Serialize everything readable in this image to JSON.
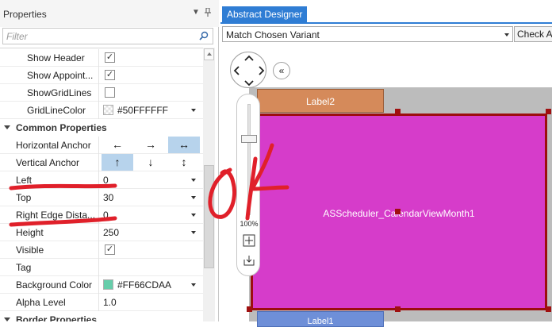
{
  "properties_panel": {
    "title": "Properties",
    "filter_placeholder": "Filter",
    "rows": [
      {
        "label": "Show Header",
        "checked": "✓"
      },
      {
        "label": "Show Appoint...",
        "checked": "✓"
      },
      {
        "label": "ShowGridLines",
        "checked": ""
      },
      {
        "label": "GridLineColor",
        "value": "#50FFFFFF"
      }
    ],
    "category_common": "Common Properties",
    "horizontal_anchor": {
      "label": "Horizontal Anchor",
      "left": "←",
      "right": "→",
      "both": "↔"
    },
    "vertical_anchor": {
      "label": "Vertical Anchor",
      "top": "↑",
      "bottom": "↓",
      "both": "↕"
    },
    "left": {
      "label": "Left",
      "value": "0"
    },
    "top": {
      "label": "Top",
      "value": "30"
    },
    "right_edge": {
      "label": "Right Edge Dista...",
      "value": "0"
    },
    "height": {
      "label": "Height",
      "value": "250"
    },
    "visible": {
      "label": "Visible",
      "checked": "✓"
    },
    "tag": {
      "label": "Tag",
      "value": ""
    },
    "background_color": {
      "label": "Background Color",
      "value": "#FF66CDAA",
      "swatch": "#66CDAA"
    },
    "alpha_level": {
      "label": "Alpha Level",
      "value": "1.0"
    },
    "category_border": "Border Properties"
  },
  "designer": {
    "tab_label": "Abstract Designer",
    "variant_select": "Match Chosen Variant",
    "check_button": "Check A",
    "zoom_label": "100%",
    "label2": "Label2",
    "calendar_name": "ASScheduler_CalendarViewMonth1",
    "label1": "Label1",
    "colors": {
      "calendar": "#D63CCA",
      "calendar_border": "#9C0E0E",
      "label2": "#D58A5A",
      "label1": "#6E8FD8"
    }
  },
  "annotation": {
    "text": "OK",
    "color": "#E0202A"
  }
}
